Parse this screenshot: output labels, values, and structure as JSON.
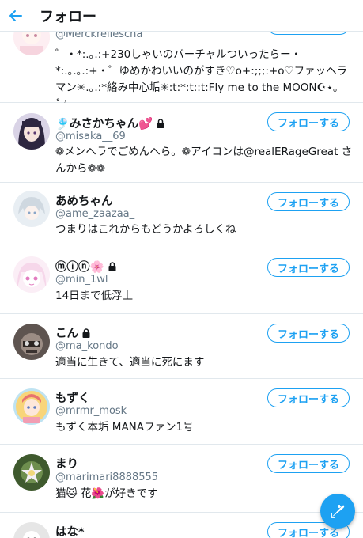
{
  "header": {
    "title": "フォロー"
  },
  "follow_label": "フォローする",
  "accent_color": "#1da1f2",
  "users": [
    {
      "name": "",
      "handle": "@Merckreliescha",
      "bio": "゜・*:.｡.:+230しゃいのバーチャルついったらー・*:.｡.｡.:+・゜ゆめかわいいのがすき♡o+:;;;:+o♡ファッヘラマン✳︎.｡.:*絡み中心垢✳︎:t:*:t::t:Fly me to the MOON☪︎⋆｡˚☆"
    },
    {
      "name": "🎐みさかちゃん💕",
      "handle": "@misaka__69",
      "bio": "❁メンヘラでごめんへら。❁アイコンは@realERageGreat さんから❁❁",
      "locked": true
    },
    {
      "name": "あめちゃん",
      "handle": "@ame_zaazaa_",
      "bio": "つまりはこれからもどうかよろしくね"
    },
    {
      "name": "ⓜⓘⓝ🌸",
      "handle": "@min_1wl",
      "bio": "14日まで低浮上",
      "locked": true
    },
    {
      "name": "こん",
      "handle": "@ma_kondo",
      "bio": "適当に生きて、適当に死にます",
      "locked": true
    },
    {
      "name": "もずく",
      "handle": "@mrmr_mosk",
      "bio": "もずく本垢 MANAファン1号"
    },
    {
      "name": "まり",
      "handle": "@marimari8888555",
      "bio": "猫🐱 花🌺が好きです"
    },
    {
      "name": "はな*",
      "handle": "",
      "bio": ""
    }
  ]
}
